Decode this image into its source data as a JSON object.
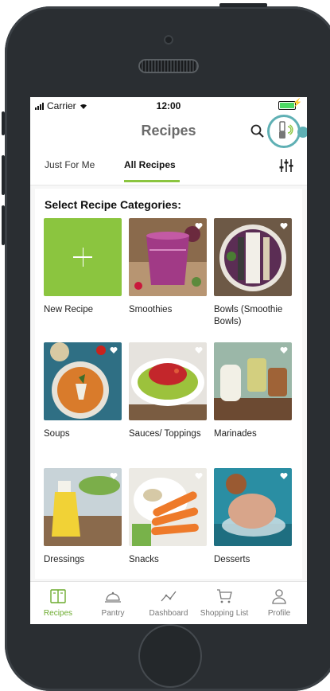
{
  "status_bar": {
    "carrier": "Carrier",
    "time": "12:00"
  },
  "header": {
    "title": "Recipes"
  },
  "tabs": [
    {
      "label": "Just For Me",
      "active": false
    },
    {
      "label": "All Recipes",
      "active": true
    }
  ],
  "section_title": "Select Recipe Categories:",
  "categories": [
    {
      "label": "New Recipe",
      "icon": "plus-icon"
    },
    {
      "label": "Smoothies"
    },
    {
      "label": "Bowls (Smoothie Bowls)"
    },
    {
      "label": "Soups"
    },
    {
      "label": "Sauces/ Toppings"
    },
    {
      "label": "Marinades"
    },
    {
      "label": "Dressings"
    },
    {
      "label": "Snacks"
    },
    {
      "label": "Desserts"
    }
  ],
  "bottom_nav": [
    {
      "label": "Recipes",
      "icon": "recipes-book-icon",
      "active": true
    },
    {
      "label": "Pantry",
      "icon": "cloche-icon",
      "active": false
    },
    {
      "label": "Dashboard",
      "icon": "chart-line-icon",
      "active": false
    },
    {
      "label": "Shopping List",
      "icon": "cart-icon",
      "active": false
    },
    {
      "label": "Profile",
      "icon": "person-icon",
      "active": false
    }
  ],
  "colors": {
    "accent_green": "#8bc53f",
    "nav_active_green": "#6cab2f",
    "device_teal": "#5fb0b4"
  }
}
